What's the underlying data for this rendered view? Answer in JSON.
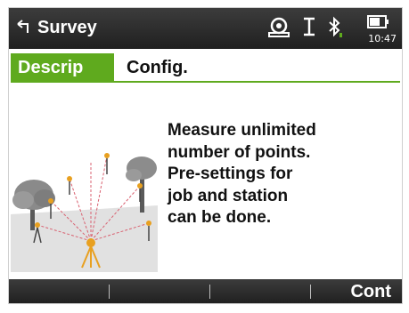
{
  "titlebar": {
    "title": "Survey",
    "time": "10:47",
    "icons": [
      "back-arrow-icon",
      "prism-target-icon",
      "cursor-i-icon",
      "bluetooth-icon",
      "battery-icon"
    ]
  },
  "tabs": [
    {
      "label": "Descrip",
      "active": true
    },
    {
      "label": "Config.",
      "active": false
    }
  ],
  "content": {
    "description_lines": [
      "Measure unlimited",
      "number of points.",
      "Pre-settings for",
      "job and station",
      "can be done."
    ],
    "illustration": "survey-scene-illustration"
  },
  "softkeys": [
    "",
    "",
    "",
    "Cont"
  ],
  "colors": {
    "accent": "#5faa1e",
    "bar_background": "#2b2b2b",
    "text": "#111111"
  }
}
